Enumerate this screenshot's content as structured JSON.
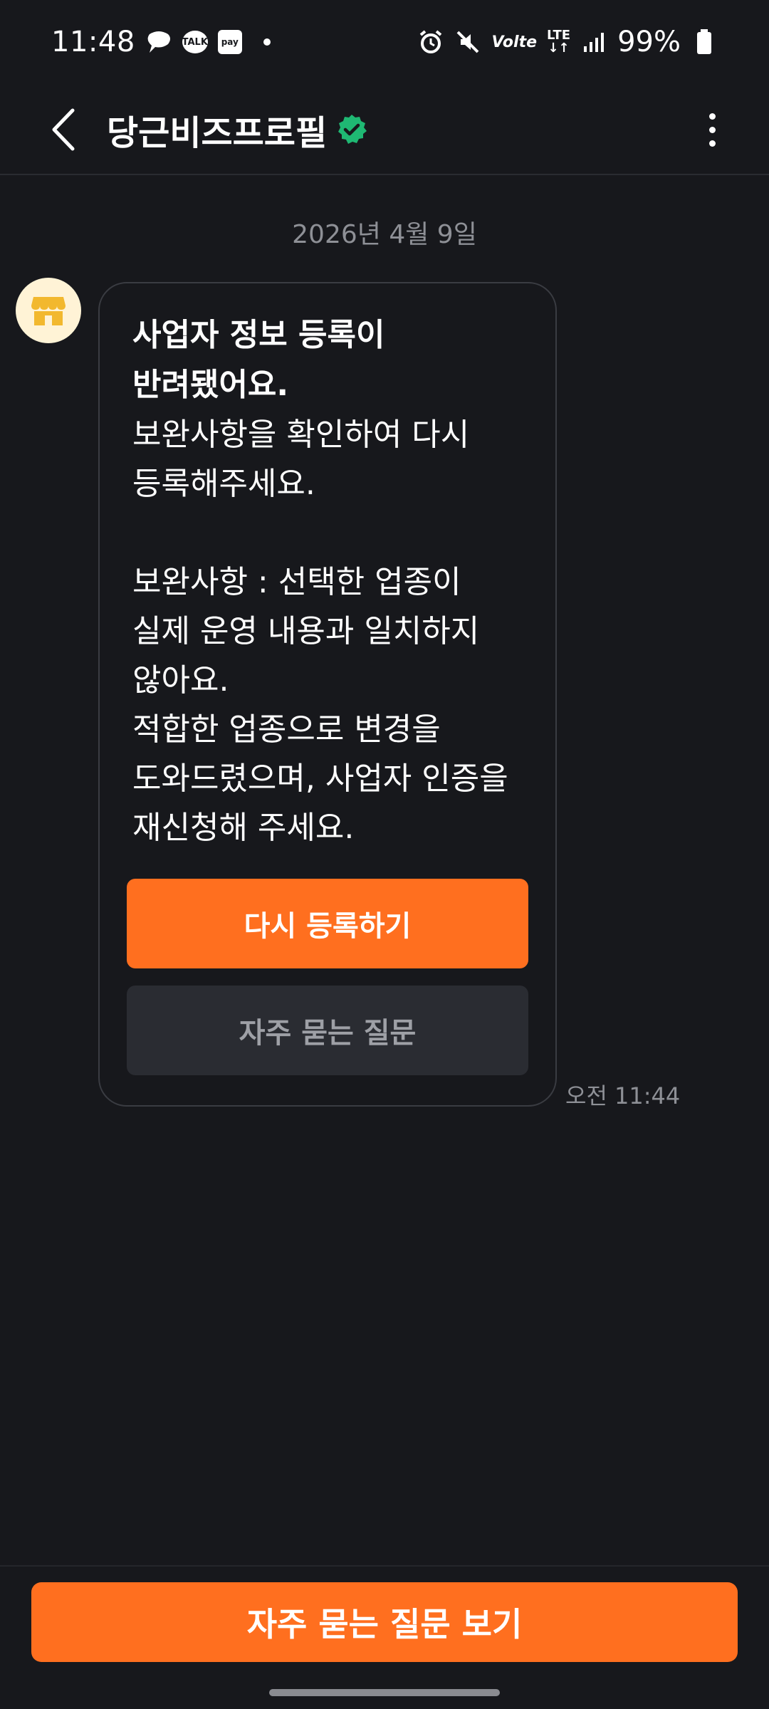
{
  "status_bar": {
    "time": "11:48",
    "kakaotalk_badge": "TALK",
    "pay_badge": "pay",
    "volte": "Volte",
    "lte": "LTE",
    "battery": "99%"
  },
  "header": {
    "title": "당근비즈프로필"
  },
  "chat": {
    "date": "2026년 4월 9일",
    "message": {
      "title": "사업자 정보 등록이\n반려됐어요.",
      "body": "보완사항을 확인하여 다시\n등록해주세요.\n\n보완사항 : 선택한 업종이\n실제 운영 내용과 일치하지\n않아요.\n적합한 업종으로 변경을\n도와드렸으며, 사업자 인증을\n재신청해 주세요.",
      "primary_button": "다시 등록하기",
      "secondary_button": "자주 묻는 질문",
      "time": "오전 11:44"
    }
  },
  "bottom": {
    "cta_label": "자주 묻는 질문 보기"
  },
  "colors": {
    "background": "#17181c",
    "accent": "#ff6f1f",
    "verified": "#1fb873",
    "avatar_bg": "#fff3d6",
    "avatar_icon": "#f2b82e"
  }
}
